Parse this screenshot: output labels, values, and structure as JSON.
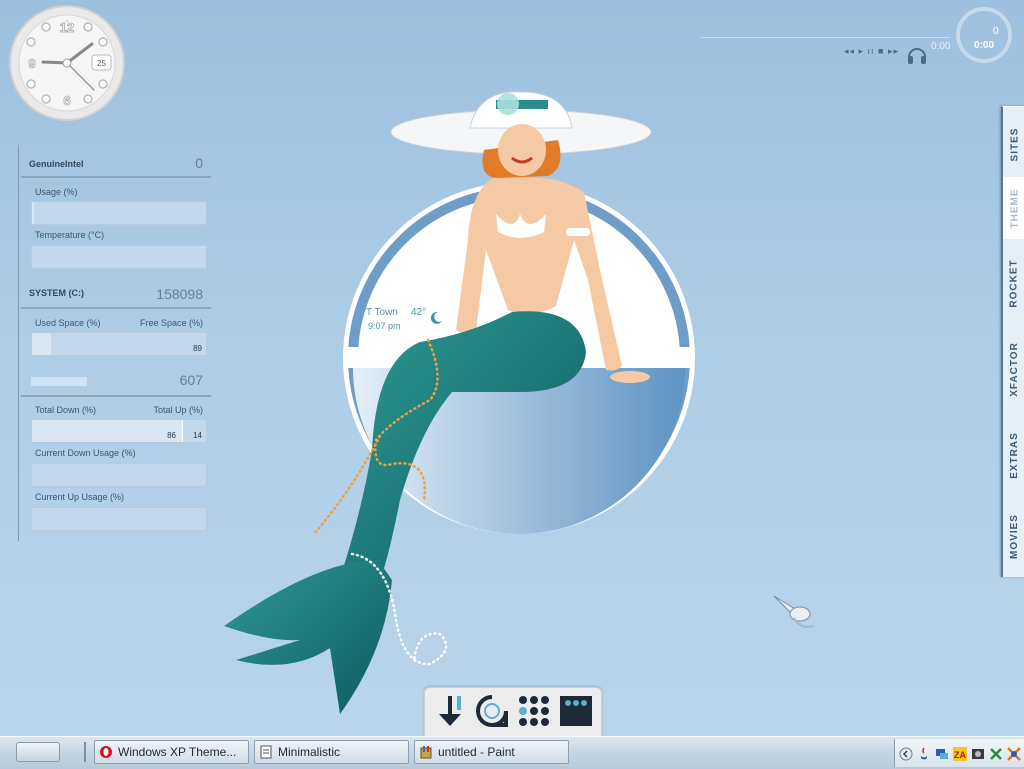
{
  "clock": {
    "date_number": "25",
    "numerals": [
      "12",
      "3",
      "6",
      "9"
    ]
  },
  "sysmon": {
    "cpu": {
      "title": "GenuineIntel",
      "value": "0",
      "usage_label": "Usage (%)",
      "temp_label": "Temperature (°C)",
      "usage_fraction": 0.01
    },
    "disk": {
      "title": "SYSTEM (C:)",
      "value": "158098",
      "used_label": "Used Space (%)",
      "free_label": "Free Space (%)",
      "free_value": "89",
      "used_fraction": 0.11
    },
    "net": {
      "value": "607",
      "down_label": "Total Down (%)",
      "up_label": "Total Up (%)",
      "down_value": "86",
      "up_value": "14",
      "cur_down_label": "Current Down Usage (%)",
      "cur_up_label": "Current Up Usage (%)",
      "down_fraction": 0.86
    }
  },
  "media": {
    "track_num": "0",
    "elapsed": "0:00",
    "total": "0:00",
    "controls": "◂◂ ▸ ıı ■ ▸▸"
  },
  "dock": {
    "items": [
      "SITES",
      "THEME",
      "ROCKET",
      "XFACTOR",
      "EXTRAS",
      "MOVIES"
    ],
    "active": "THEME"
  },
  "weather": {
    "city": "T Town",
    "temp": "42°",
    "time": "9:07 pm"
  },
  "launcher": {
    "icons": [
      "download-icon",
      "speech-icon",
      "grid-icon",
      "monitor-icon"
    ]
  },
  "taskbar": {
    "tasks": [
      {
        "label": "Windows XP Theme...",
        "icon": "opera-icon"
      },
      {
        "label": "Minimalistic",
        "icon": "document-icon"
      },
      {
        "label": "untitled - Paint",
        "icon": "paint-icon"
      }
    ],
    "tray_icons": [
      "expand-icon",
      "java-icon",
      "network-icon",
      "zonealarm-icon",
      "media-icon",
      "tools-icon",
      "bug-icon"
    ]
  },
  "colors": {
    "accent": "#2a8d8a",
    "background": "#a9c9e3",
    "text": "#4a6178"
  }
}
